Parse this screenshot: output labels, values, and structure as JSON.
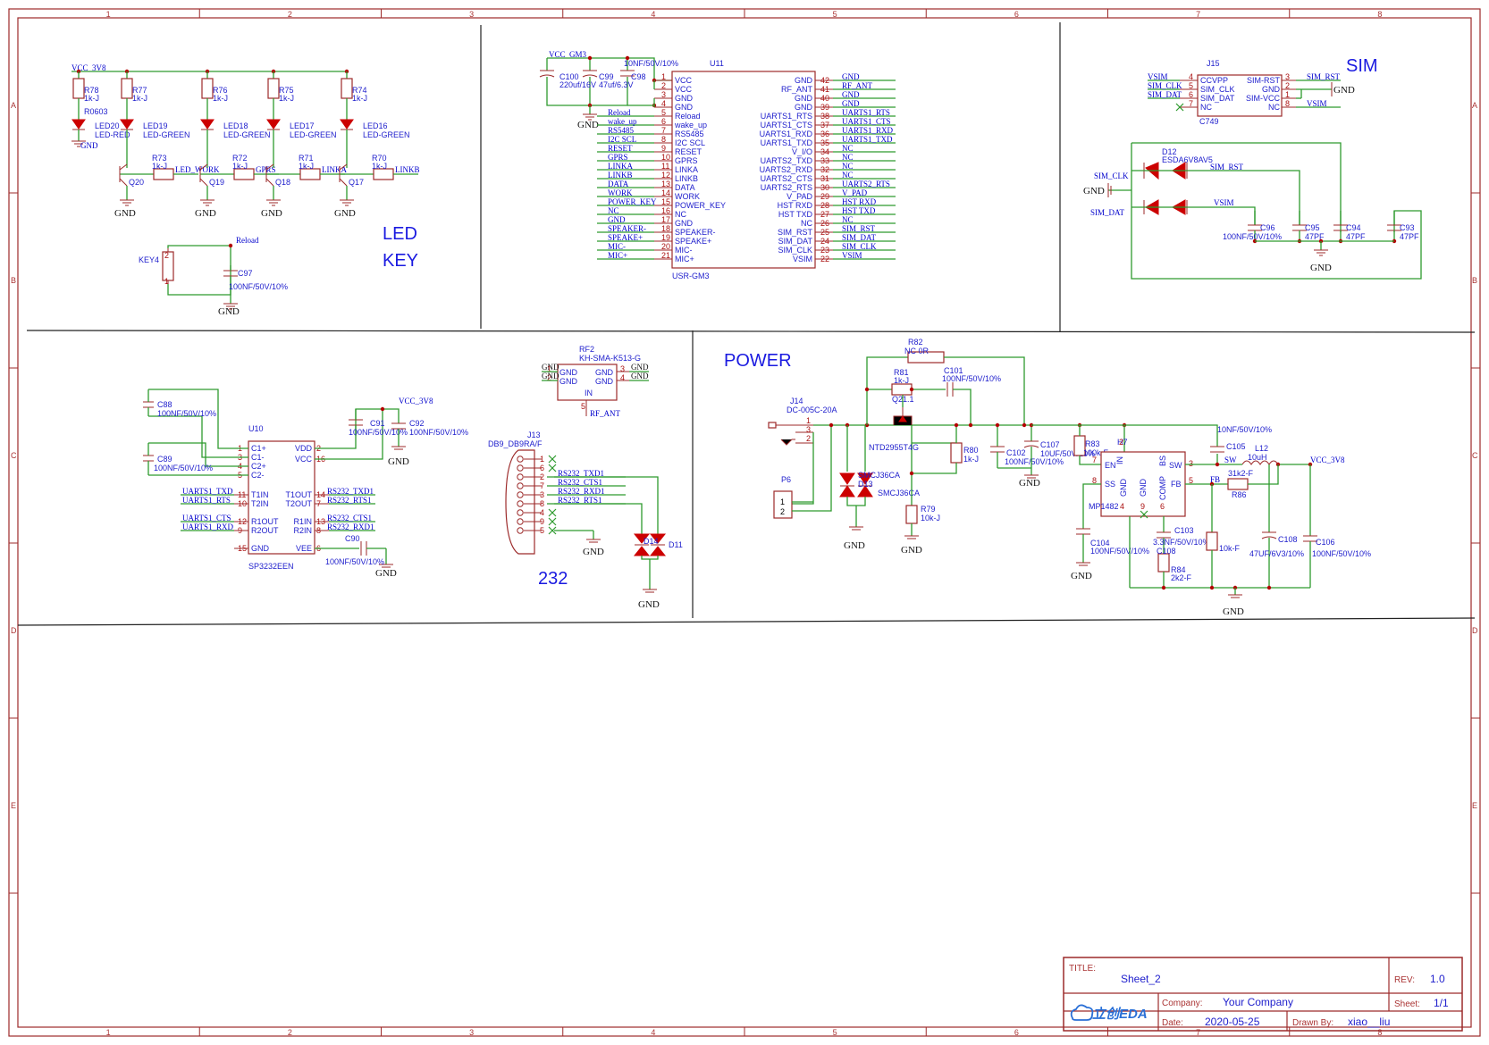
{
  "border": {
    "columns": [
      "1",
      "2",
      "3",
      "4",
      "5",
      "6",
      "7",
      "8"
    ],
    "rows": [
      "A",
      "B",
      "C",
      "D",
      "E"
    ]
  },
  "sections": {
    "led_key": [
      "LED",
      "KEY"
    ],
    "sim": "SIM",
    "power": "POWER",
    "rs232": "232"
  },
  "led_key": {
    "vcc": "VCC_3V8",
    "resistors_top": [
      {
        "ref": "R78",
        "val": "1k-J",
        "pkg": "R0603"
      },
      {
        "ref": "R77",
        "val": "1k-J"
      },
      {
        "ref": "R76",
        "val": "1k-J"
      },
      {
        "ref": "R75",
        "val": "1k-J"
      },
      {
        "ref": "R74",
        "val": "1k-J"
      }
    ],
    "leds": [
      {
        "ref": "LED20",
        "type": "LED-RED"
      },
      {
        "ref": "LED19",
        "type": "LED-GREEN"
      },
      {
        "ref": "LED18",
        "type": "LED-GREEN"
      },
      {
        "ref": "LED17",
        "type": "LED-GREEN"
      },
      {
        "ref": "LED16",
        "type": "LED-GREEN"
      }
    ],
    "base_resistors": [
      {
        "ref": "R73",
        "val": "1k-J",
        "net": "LED_WORK"
      },
      {
        "ref": "R72",
        "val": "1k-J",
        "net": "GPRS"
      },
      {
        "ref": "R71",
        "val": "1k-J",
        "net": "LINKA"
      },
      {
        "ref": "R70",
        "val": "1k-J",
        "net": "LINKB"
      }
    ],
    "transistors": [
      "Q20",
      "Q19",
      "Q18",
      "Q17"
    ],
    "key": {
      "ref": "KEY4",
      "net": "Reload",
      "cap": "C97",
      "cap_val": "100NF/50V/10%",
      "pin1": "1",
      "pin2": "2"
    },
    "gnd": "GND"
  },
  "gm3": {
    "ref": "U11",
    "part": "USR-GM3",
    "net_vcc": "VCC_GM3",
    "caps": [
      {
        "ref": "C100",
        "val": "220uf/16V"
      },
      {
        "ref": "C99",
        "val": "47uf/6.3V"
      },
      {
        "ref": "C98",
        "val": "10NF/50V/10%"
      }
    ],
    "left_pins": [
      {
        "num": "1",
        "name": "VCC",
        "net": ""
      },
      {
        "num": "2",
        "name": "VCC",
        "net": ""
      },
      {
        "num": "3",
        "name": "GND",
        "net": ""
      },
      {
        "num": "4",
        "name": "GND",
        "net": ""
      },
      {
        "num": "5",
        "name": "Reload",
        "net": "Reload"
      },
      {
        "num": "6",
        "name": "wake_up",
        "net": "wake_up"
      },
      {
        "num": "7",
        "name": "RS5485",
        "net": "RS5485"
      },
      {
        "num": "8",
        "name": "I2C SCL",
        "net": "I2C SCL"
      },
      {
        "num": "9",
        "name": "RESET",
        "net": "RESET"
      },
      {
        "num": "10",
        "name": "GPRS",
        "net": "GPRS"
      },
      {
        "num": "11",
        "name": "LINKA",
        "net": "LINKA"
      },
      {
        "num": "12",
        "name": "LINKB",
        "net": "LINKB"
      },
      {
        "num": "13",
        "name": "DATA",
        "net": "DATA"
      },
      {
        "num": "14",
        "name": "WORK",
        "net": "WORK"
      },
      {
        "num": "15",
        "name": "POWER_KEY",
        "net": "POWER_KEY"
      },
      {
        "num": "16",
        "name": "NC",
        "net": "NC"
      },
      {
        "num": "17",
        "name": "GND",
        "net": "GND"
      },
      {
        "num": "18",
        "name": "SPEAKER-",
        "net": "SPEAKER-"
      },
      {
        "num": "19",
        "name": "SPEAKE+",
        "net": "SPEAKE+"
      },
      {
        "num": "20",
        "name": "MIC-",
        "net": "MIC-"
      },
      {
        "num": "21",
        "name": "MIC+",
        "net": "MIC+"
      }
    ],
    "right_pins": [
      {
        "num": "42",
        "name": "GND",
        "net": "GND"
      },
      {
        "num": "41",
        "name": "RF_ANT",
        "net": "RF_ANT"
      },
      {
        "num": "40",
        "name": "GND",
        "net": "GND"
      },
      {
        "num": "39",
        "name": "GND",
        "net": "GND"
      },
      {
        "num": "38",
        "name": "UARTS1_RTS",
        "net": "UARTS1_RTS"
      },
      {
        "num": "37",
        "name": "UARTS1_CTS",
        "net": "UARTS1_CTS"
      },
      {
        "num": "36",
        "name": "UARTS1_RXD",
        "net": "UARTS1_RXD"
      },
      {
        "num": "35",
        "name": "UARTS1_TXD",
        "net": "UARTS1_TXD"
      },
      {
        "num": "34",
        "name": "V_I/O",
        "net": "NC"
      },
      {
        "num": "33",
        "name": "UARTS2_TXD",
        "net": "NC"
      },
      {
        "num": "32",
        "name": "UARTS2_RXD",
        "net": "NC"
      },
      {
        "num": "31",
        "name": "UARTS2_CTS",
        "net": "NC"
      },
      {
        "num": "30",
        "name": "UARTS2_RTS",
        "net": "UARTS2_RTS"
      },
      {
        "num": "29",
        "name": "V_PAD",
        "net": "V_PAD"
      },
      {
        "num": "28",
        "name": "HST RXD",
        "net": "HST RXD"
      },
      {
        "num": "27",
        "name": "HST TXD",
        "net": "HST TXD"
      },
      {
        "num": "26",
        "name": "NC",
        "net": "NC"
      },
      {
        "num": "25",
        "name": "SIM_RST",
        "net": "SIM_RST"
      },
      {
        "num": "24",
        "name": "SIM_DAT",
        "net": "SIM_DAT"
      },
      {
        "num": "23",
        "name": "SIM_CLK",
        "net": "SIM_CLK"
      },
      {
        "num": "22",
        "name": "VSIM",
        "net": "VSIM"
      }
    ]
  },
  "sim": {
    "ref": "J15",
    "part": "C749",
    "left_pins": [
      {
        "net": "VSIM",
        "num": "4",
        "name": "CCVPP"
      },
      {
        "net": "SIM_CLK",
        "num": "5",
        "name": "SIM_CLK"
      },
      {
        "net": "SIM_DAT",
        "num": "6",
        "name": "SIM_DAT"
      },
      {
        "net": "",
        "num": "7",
        "name": "NC"
      }
    ],
    "right_pins": [
      {
        "net": "SIM_RST",
        "num": "3",
        "name": "SIM-RST"
      },
      {
        "net": "GND",
        "num": "2",
        "name": "GND"
      },
      {
        "net": "",
        "num": "1",
        "name": "SIM-VCC"
      },
      {
        "net": "VSIM",
        "num": "8",
        "name": "NC"
      }
    ],
    "esd": {
      "ref": "D12",
      "part": "ESDA6V8AV5"
    },
    "nets": {
      "clk": "SIM_CLK",
      "dat": "SIM_DAT",
      "rst": "SIM_RST",
      "vsim": "VSIM"
    },
    "caps": [
      {
        "ref": "C96",
        "val": "100NF/50V/10%"
      },
      {
        "ref": "C95",
        "val": "47PF"
      },
      {
        "ref": "C94",
        "val": "47PF"
      },
      {
        "ref": "C93",
        "val": "47PF"
      }
    ],
    "gnd": "GND"
  },
  "rs232": {
    "ic": {
      "ref": "U10",
      "part": "SP3232EEN"
    },
    "caps": [
      {
        "ref": "C88",
        "val": "100NF/50V/10%"
      },
      {
        "ref": "C89",
        "val": "100NF/50V/10%"
      },
      {
        "ref": "C91",
        "val": "100NF/50V/10%"
      },
      {
        "ref": "C92",
        "val": "100NF/50V/10%"
      },
      {
        "ref": "C90",
        "val": "100NF/50V/10%"
      }
    ],
    "vcc": "VCC_3V8",
    "left_pins": [
      {
        "num": "1",
        "name": "C1+",
        "net": ""
      },
      {
        "num": "3",
        "name": "C1-",
        "net": ""
      },
      {
        "num": "4",
        "name": "C2+",
        "net": ""
      },
      {
        "num": "5",
        "name": "C2-",
        "net": ""
      },
      {
        "num": "11",
        "name": "T1IN",
        "net": "UARTS1_TXD"
      },
      {
        "num": "10",
        "name": "T2IN",
        "net": "UARTS1_RTS"
      },
      {
        "num": "12",
        "name": "R1OUT",
        "net": "UARTS1_CTS"
      },
      {
        "num": "9",
        "name": "R2OUT",
        "net": "UARTS1_RXD"
      },
      {
        "num": "15",
        "name": "GND",
        "net": ""
      }
    ],
    "right_pins": [
      {
        "num": "2",
        "name": "VDD",
        "net": ""
      },
      {
        "num": "16",
        "name": "VCC",
        "net": ""
      },
      {
        "num": "14",
        "name": "T1OUT",
        "net": "RS232_TXD1"
      },
      {
        "num": "7",
        "name": "T2OUT",
        "net": "RS232_RTS1"
      },
      {
        "num": "13",
        "name": "R1IN",
        "net": "RS232_CTS1"
      },
      {
        "num": "8",
        "name": "R2IN",
        "net": "RS232_RXD1"
      },
      {
        "num": "6",
        "name": "VEE",
        "net": ""
      }
    ],
    "rf": {
      "ref": "RF2",
      "part": "KH-SMA-K513-G",
      "pins": [
        "1",
        "2",
        "3",
        "4",
        "5"
      ],
      "pin_names": [
        "GND",
        "GND",
        "GND",
        "GND",
        "IN"
      ],
      "net": "RF_ANT"
    },
    "db9": {
      "ref": "J13",
      "part": "DB9_DB9RA/F",
      "pins": [
        "1",
        "6",
        "2",
        "7",
        "3",
        "8",
        "4",
        "9",
        "5"
      ],
      "nets": [
        "",
        "",
        "RS232_TXD1",
        "RS232_CTS1",
        "RS232_RXD1",
        "RS232_RTS1",
        "",
        "",
        ""
      ]
    },
    "tvs": [
      "D14",
      "D11"
    ],
    "gnd": "GND"
  },
  "power": {
    "jack": {
      "ref": "J14",
      "part": "DC-005C-20A",
      "pins": [
        "1",
        "3",
        "2"
      ]
    },
    "header": {
      "ref": "P6",
      "pins": [
        "1",
        "2"
      ]
    },
    "r82": {
      "ref": "R82",
      "val": "NC 0R"
    },
    "r81": {
      "ref": "R81",
      "val": "1k-J"
    },
    "c101": {
      "ref": "C101",
      "val": "100NF/50V/10%"
    },
    "q21": {
      "ref": "Q21.1",
      "part": "NTD2955T4G"
    },
    "tvs": [
      {
        "ref": "SMCJ36CA",
        "label": "D13"
      },
      {
        "ref": "SMCJ36CA",
        "label": "D13"
      }
    ],
    "tvs_labels": [
      "SMCJ36CA",
      "D13",
      "SMCJ36CA"
    ],
    "r80": {
      "ref": "R80",
      "val": "1k-J"
    },
    "r79": {
      "ref": "R79",
      "val": "10k-J"
    },
    "c102": {
      "ref": "C102",
      "val": "100NF/50V/10%"
    },
    "c107": {
      "ref": "C107",
      "val": "10UF/50V/10%"
    },
    "r83": {
      "ref": "R83",
      "val": "100k-F"
    },
    "ic": {
      "ref": "H7",
      "part": "MP1482",
      "pins": {
        "in": "2",
        "en": "7",
        "ss": "8",
        "gnd": "4",
        "nc": "9",
        "comp": "6",
        "bs": "1",
        "sw": "3",
        "fb": "5"
      },
      "names": {
        "in": "IN",
        "en": "EN",
        "ss": "SS",
        "gnd": "GND",
        "gnd2": "GND",
        "comp": "COMP",
        "bs": "BS",
        "sw": "SW",
        "fb": "FB"
      }
    },
    "c105": {
      "ref": "C105",
      "val": "10NF/50V/10%"
    },
    "l12": {
      "ref": "L12",
      "val": "10uH",
      "net": "SW"
    },
    "r86": {
      "ref": "R86",
      "val": "31k2-F",
      "net": "FB"
    },
    "c104": {
      "ref": "C104",
      "val": "100NF/50V/10%"
    },
    "c103": {
      "ref": "C103",
      "val": "3.3NF/50V/10%"
    },
    "c108": {
      "ref": "C108",
      "val": "47UF/6V3/10%"
    },
    "c108b": "C108",
    "c106": {
      "ref": "C106",
      "val": "100NF/50V/10%"
    },
    "r84": {
      "ref": "R84",
      "val": "2k2-F"
    },
    "r_fb": {
      "val": "10k-F"
    },
    "vcc": "VCC_3V8",
    "gnd": "GND"
  },
  "title_block": {
    "title_label": "TITLE:",
    "title": "Sheet_2",
    "rev_label": "REV:",
    "rev": "1.0",
    "company_label": "Company:",
    "company": "Your Company",
    "sheet_label": "Sheet:",
    "sheet": "1/1",
    "date_label": "Date:",
    "date": "2020-05-25",
    "drawn_label": "Drawn By:",
    "drawn": "xiao__liu",
    "logo": "立创EDA"
  }
}
